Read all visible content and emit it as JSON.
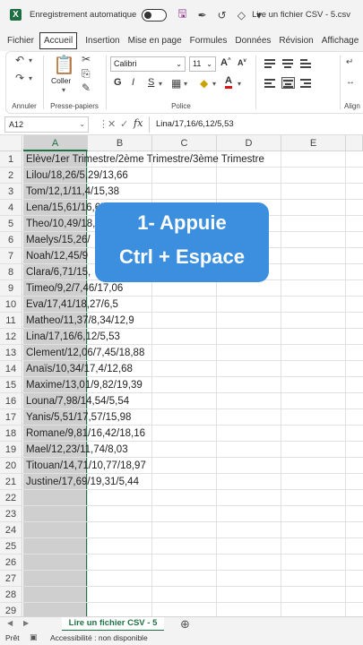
{
  "titlebar": {
    "autosave_label": "Enregistrement automatique",
    "file_title": "Lire un fichier CSV - 5.csv"
  },
  "menu": [
    "Fichier",
    "Accueil",
    "Insertion",
    "Mise en page",
    "Formules",
    "Données",
    "Révision",
    "Affichage"
  ],
  "ribbon": {
    "undo_group": "Annuler",
    "clipboard_group": "Presse-papiers",
    "paste_label": "Coller",
    "font_group": "Police",
    "font_name": "Calibri",
    "font_size": "11",
    "align_group": "Align"
  },
  "formulabar": {
    "name_box": "A12",
    "fx": "fx",
    "formula": "Lina/17,16/6,12/5,53"
  },
  "columns": [
    "A",
    "B",
    "C",
    "D",
    "E"
  ],
  "rows": [
    "1",
    "2",
    "3",
    "4",
    "5",
    "6",
    "7",
    "8",
    "9",
    "10",
    "11",
    "12",
    "13",
    "14",
    "15",
    "16",
    "17",
    "18",
    "19",
    "20",
    "21",
    "22",
    "23",
    "24",
    "25",
    "26",
    "27",
    "28",
    "29"
  ],
  "cells": [
    "Elève/1er Trimestre/2ème Trimestre/3ème Trimestre",
    "Lilou/18,26/5,29/13,66",
    "Tom/12,1/11,4/15,38",
    "Lena/15,61/16,65",
    "Theo/10,49/18,23",
    "Maelys/15,26/",
    "Noah/12,45/9",
    "Clara/6,71/15,",
    "Timeo/9,2/7,46/17,06",
    "Eva/17,41/18,27/6,5",
    "Matheo/11,37/8,34/12,9",
    "Lina/17,16/6,12/5,53",
    "Clement/12,06/7,45/18,88",
    "Anaïs/10,34/17,4/12,68",
    "Maxime/13,01/9,82/19,39",
    "Louna/7,98/14,54/5,54",
    "Yanis/5,51/17,57/15,98",
    "Romane/9,81/16,42/18,16",
    "Mael/12,23/11,74/8,03",
    "Titouan/14,71/10,77/18,97",
    "Justine/17,69/19,31/5,44"
  ],
  "callout": {
    "line1": "1-  Appuie",
    "line2": "Ctrl + Espace"
  },
  "sheet_tab": "Lire un fichier CSV - 5",
  "status": {
    "ready": "Prêt",
    "accessibility": "Accessibilité : non disponible"
  },
  "colors": {
    "excel_green": "#1e7145",
    "callout_blue": "#3b8fde",
    "selection_gray": "#cfcfcf"
  }
}
